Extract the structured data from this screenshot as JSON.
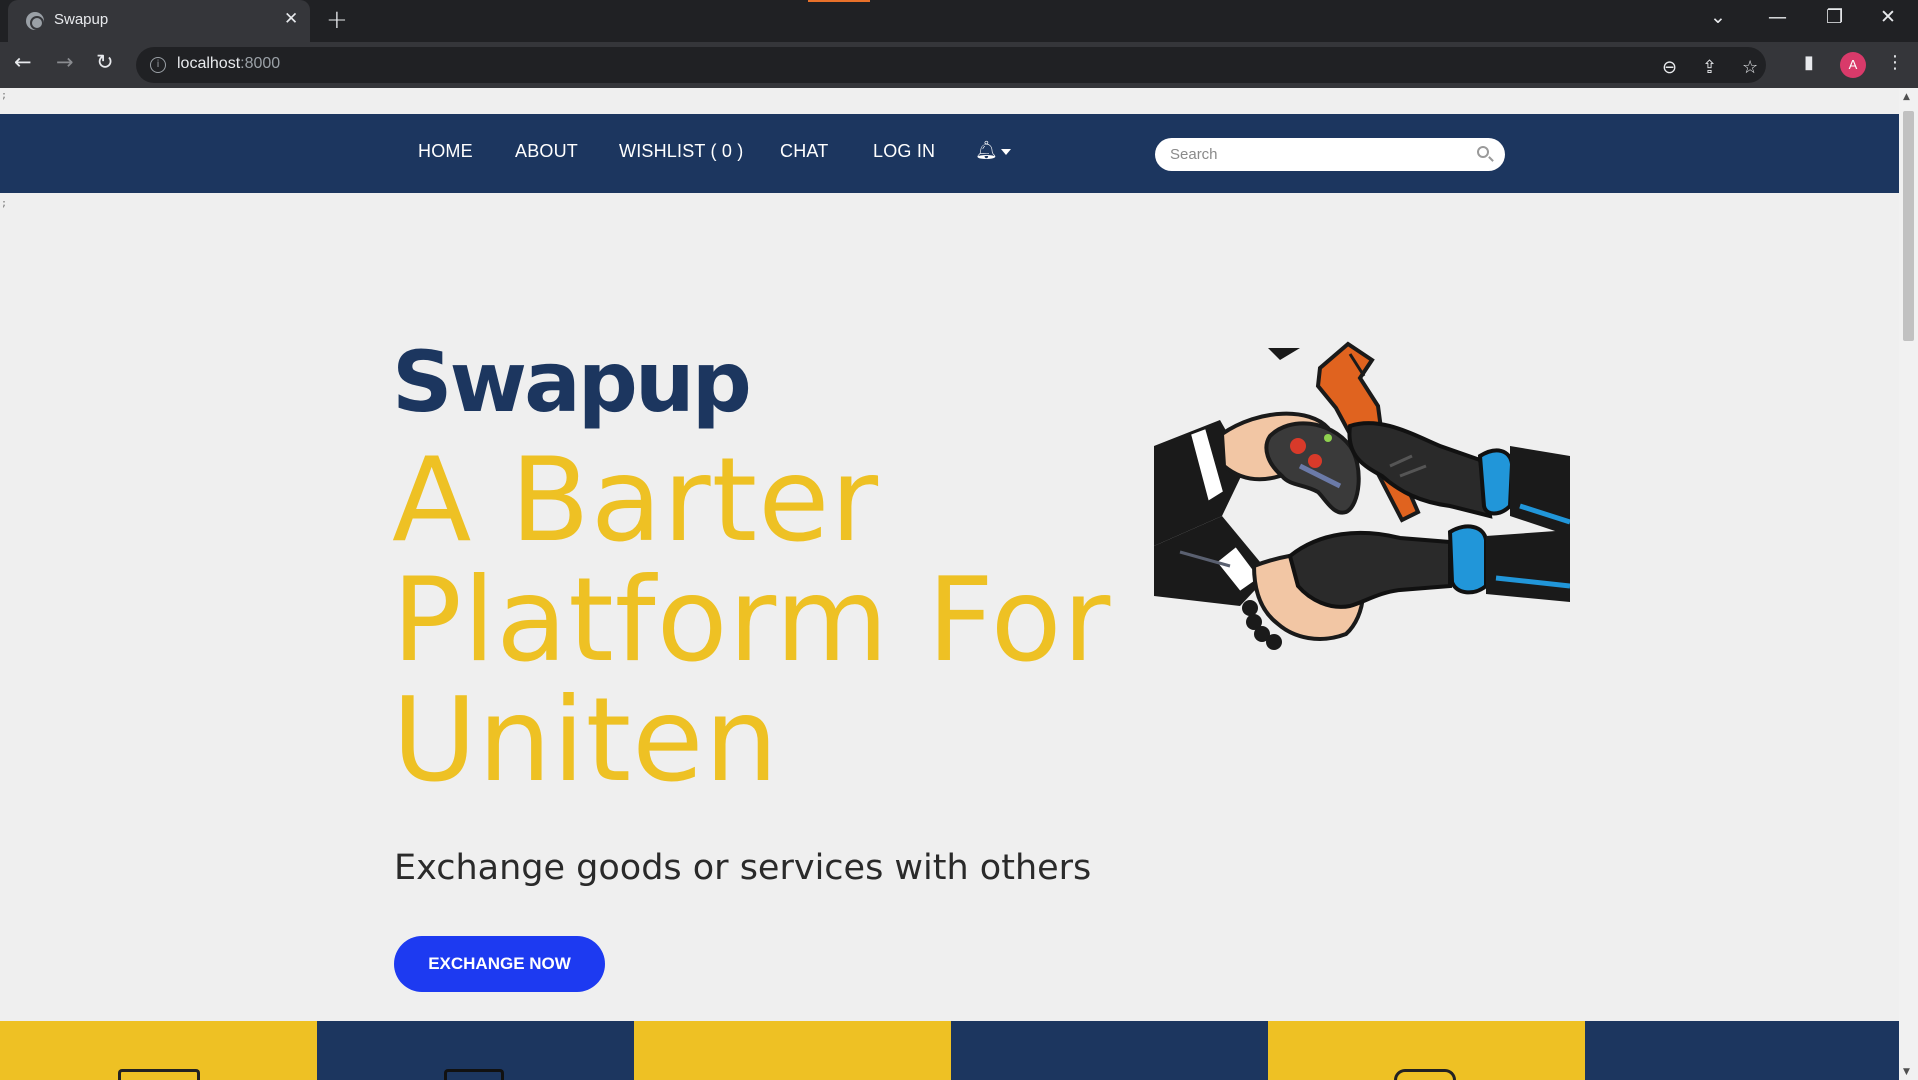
{
  "browser": {
    "tab_title": "Swapup",
    "tab_close": "✕",
    "new_tab": "+",
    "url_host": "localhost",
    "url_port": ":8000",
    "avatar_letter": "A"
  },
  "nav": {
    "items": [
      "HOME",
      "ABOUT",
      "WISHLIST ( 0 )",
      "CHAT",
      "LOG IN"
    ],
    "notification_icon": "bell-icon",
    "search_placeholder": "Search"
  },
  "hero": {
    "brand": "Swapup",
    "headline": "A Barter Platform For Uniten",
    "subheadline": "Exchange goods or services with others",
    "cta_label": "EXCHANGE NOW",
    "image": "handshake-trade-illustration"
  },
  "colors": {
    "navy": "#1c365f",
    "gold": "#eec124",
    "cta_blue": "#1d3af1",
    "page_bg": "#efefef"
  },
  "stripes": [
    "gold",
    "navy",
    "gold",
    "navy",
    "gold",
    "navy"
  ]
}
